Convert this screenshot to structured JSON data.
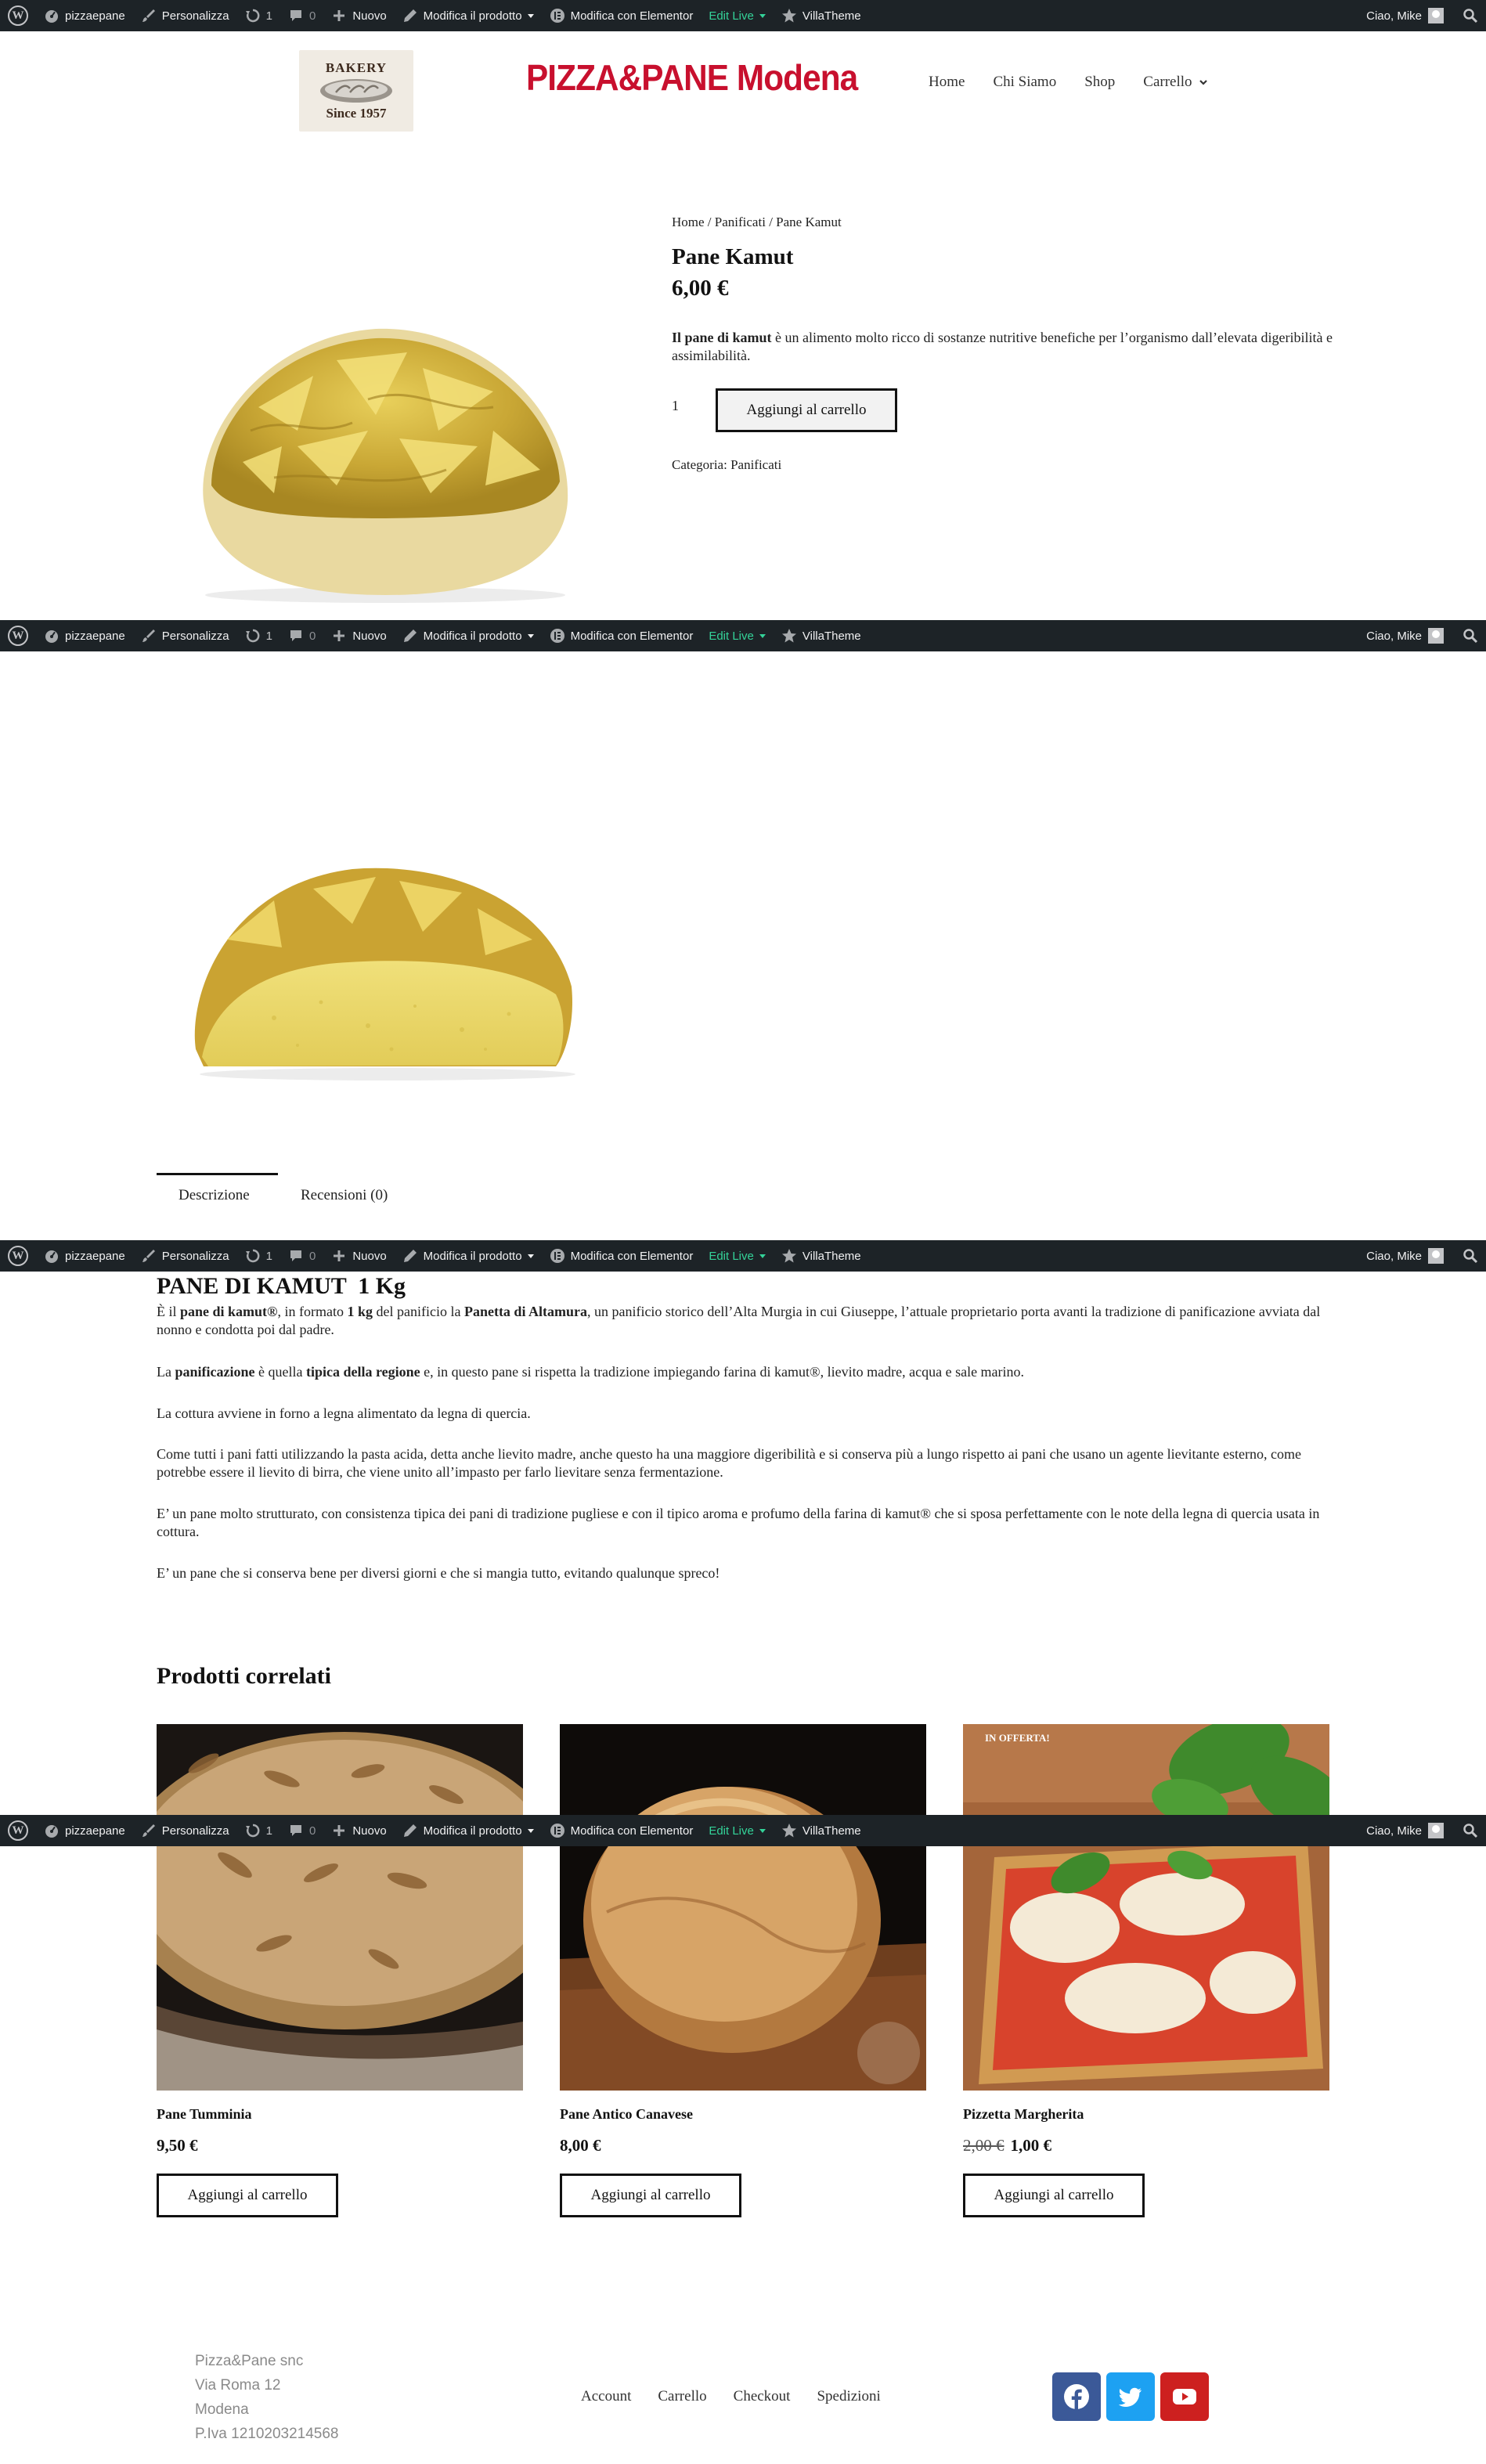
{
  "adminbar": {
    "site_name": "pizzaepane",
    "customize": "Personalizza",
    "updates_count": "1",
    "comments_count": "0",
    "new": "Nuovo",
    "edit_product": "Modifica il prodotto",
    "elementor": "Modifica con Elementor",
    "edit_live": "Edit Live",
    "theme": "VillaTheme",
    "greeting": "Ciao, Mike"
  },
  "header": {
    "logo_top": "BAKERY",
    "logo_bottom": "Since 1957",
    "site_title": "PIZZA&PANE Modena",
    "nav": [
      "Home",
      "Chi Siamo",
      "Shop",
      "Carrello"
    ]
  },
  "breadcrumb": {
    "home": "Home",
    "sep": " / ",
    "category": "Panificati",
    "current": "Pane Kamut"
  },
  "product": {
    "title": "Pane Kamut",
    "price": "6,00 €",
    "short_desc_bold": "Il pane di kamut",
    "short_desc_rest": " è un alimento molto ricco di sostanze nutritive benefiche per l’organismo dall’elevata digeribilità e assimilabilità.",
    "qty": "1",
    "add_to_cart": "Aggiungi al carrello",
    "category_label": "Categoria: ",
    "category_value": "Panificati"
  },
  "tabs": {
    "description": "Descrizione",
    "reviews": "Recensioni (0)"
  },
  "description": {
    "title": "PANE DI KAMUT  1 Kg",
    "p1": {
      "a": "È il ",
      "b1": "pane di kamut®",
      "c": ", in formato ",
      "b2": "1 kg",
      "d": " del panificio la ",
      "b3": "Panetta di Altamura",
      "e": ", un panificio storico dell’Alta Murgia in cui Giuseppe, l’attuale proprietario porta avanti la tradizione di panificazione avviata dal nonno e condotta poi dal padre."
    },
    "p2": {
      "a": "La ",
      "b1": "panificazione",
      "c": " è quella ",
      "b2": "tipica della regione",
      "d": " e, in questo pane si rispetta la tradizione impiegando farina di kamut®, lievito madre, acqua e sale marino."
    },
    "p3": "La cottura avviene in forno a legna alimentato da legna di quercia.",
    "p4": "Come tutti i pani fatti utilizzando la pasta acida, detta anche lievito madre, anche questo ha una maggiore digeribilità e si conserva più a lungo rispetto ai pani che usano un agente lievitante esterno, come potrebbe essere il lievito di birra, che viene unito all’impasto per farlo lievitare senza fermentazione.",
    "p5": "E’ un pane molto strutturato, con consistenza tipica dei pani di tradizione pugliese e con il tipico aroma e profumo della farina di kamut® che si sposa perfettamente con le note della legna di quercia usata in cottura.",
    "p6": "E’ un pane che si conserva bene per diversi giorni e che si mangia tutto, evitando qualunque spreco!"
  },
  "related": {
    "title": "Prodotti correlati",
    "offer_badge": "IN OFFERTA!",
    "items": [
      {
        "name": "Pane Tumminia",
        "price": "9,50 €",
        "old_price": "",
        "button": "Aggiungi al carrello"
      },
      {
        "name": "Pane Antico Canavese",
        "price": "8,00 €",
        "old_price": "",
        "button": "Aggiungi al carrello"
      },
      {
        "name": "Pizzetta Margherita",
        "price": "1,00 €",
        "old_price": "2,00 €",
        "button": "Aggiungi al carrello"
      }
    ]
  },
  "footer": {
    "company": [
      "Pizza&Pane snc",
      "Via Roma 12",
      "Modena",
      "P.Iva 1210203214568"
    ],
    "links": [
      "Account",
      "Carrello",
      "Checkout",
      "Spedizioni"
    ],
    "social": [
      {
        "icon": "facebook-icon",
        "color": "#3b5998"
      },
      {
        "icon": "twitter-icon",
        "color": "#1da1f2"
      },
      {
        "icon": "youtube-icon",
        "color": "#cd201f"
      }
    ]
  },
  "colors": {
    "adminbar_bg": "#1d2327",
    "edit_live": "#34d399",
    "site_title": "#c8102e"
  }
}
